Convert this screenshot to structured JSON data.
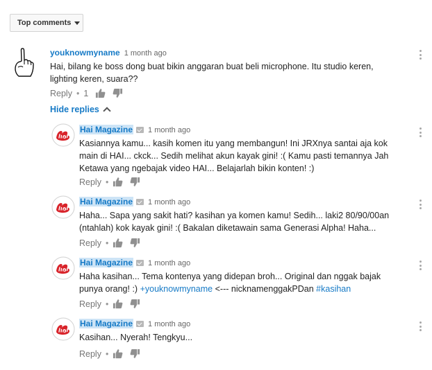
{
  "sort": {
    "label": "Top comments"
  },
  "top_comment": {
    "author": "youknowmyname",
    "time": "1 month ago",
    "text_line1": "Hai, bilang ke boss dong buat bikin anggaran buat beli microphone. Itu studio keren,",
    "text_line2": "lighting keren, suara??",
    "reply_label": "Reply",
    "like_count": "1"
  },
  "hide_replies": {
    "label": "Hide replies"
  },
  "replies": [
    {
      "author": "Hai Magazine",
      "time": "1 month ago",
      "line1": "Kasiannya kamu... kasih komen itu yang membangun! Ini JRXnya santai aja kok",
      "line2": "main di HAI... ckck... Sedih melihat akun kayak gini! :( Kamu pasti temannya Jah",
      "line3": "Ketawa yang ngebajak video HAI... Belajarlah bikin konten! :)",
      "reply_label": "Reply"
    },
    {
      "author": "Hai Magazine",
      "time": "1 month ago",
      "line1": "Haha... Sapa yang sakit hati? kasihan ya komen kamu! Sedih... laki2 80/90/00an",
      "line2": "(ntahlah) kok kayak gini! :( Bakalan diketawain sama Generasi Alpha! Haha...",
      "reply_label": "Reply"
    },
    {
      "author": "Hai Magazine",
      "time": "1 month ago",
      "line1": "Haha kasihan... Tema kontenya yang didepan broh... Original dan nggak bajak",
      "line2_pre": "punya orang! :) ",
      "line2_mention": "+youknowmyname",
      "line2_mid": " <--- nicknamenggakPDan ",
      "line2_tag": "#kasihan",
      "reply_label": "Reply"
    },
    {
      "author": "Hai Magazine",
      "time": "1 month ago",
      "line1": "Kasihan... Nyerah! Tengkyu...",
      "reply_label": "Reply"
    }
  ],
  "icons": {
    "avatar_top": "middle-finger-hand-drawing",
    "avatar_reply": "hai-magazine-logo",
    "like": "thumbs-up-icon",
    "dislike": "thumbs-down-icon",
    "menu": "vertical-dots-icon"
  },
  "colors": {
    "link": "#167ac6",
    "highlight": "#cde4f6",
    "muted": "#767676",
    "logo_red": "#d8232a"
  }
}
